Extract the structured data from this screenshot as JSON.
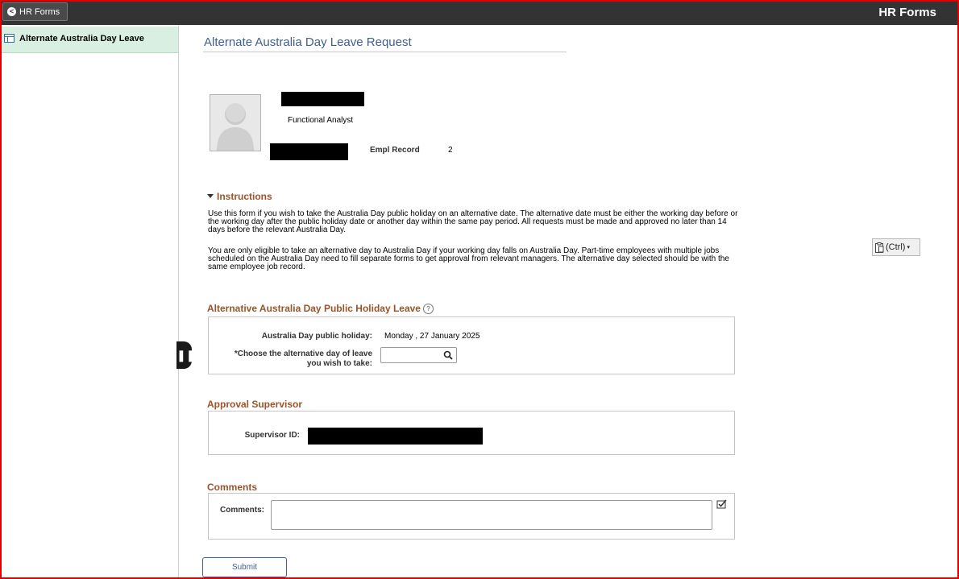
{
  "header": {
    "back_label": "HR Forms",
    "app_title": "HR Forms"
  },
  "sidebar": {
    "items": [
      {
        "label": "Alternate Australia Day Leave"
      }
    ]
  },
  "page": {
    "title": "Alternate Australia Day Leave Request"
  },
  "employee": {
    "job_title": "Functional Analyst",
    "empl_record_label": "Empl Record",
    "empl_record_value": "2"
  },
  "instructions": {
    "header": "Instructions",
    "paragraphs": [
      "Use this form if you wish to take the Australia Day public holiday on an alternative date. The alternative date must be either the working day before or the working day after the public holiday date or another day within the same pay period. All requests must be made and approved no later than 14 days before the relevant Australia Day.",
      "You are only eligible to take an alternative day to Australia Day if your working day falls on Australia Day. Part-time employees with multiple jobs scheduled on the Australia Day need to fill separate forms to get approval from relevant managers. The alternative day selected should be with the same employee job record."
    ]
  },
  "leave": {
    "header": "Alternative Australia Day Public Holiday Leave",
    "holiday_label": "Australia Day public holiday:",
    "holiday_value": "Monday   , 27 January 2025",
    "choose_label_1": "*Choose the alternative day of leave",
    "choose_label_2": "you wish to take:",
    "date_value": ""
  },
  "approval": {
    "header": "Approval Supervisor",
    "supervisor_label": "Supervisor ID:"
  },
  "comments": {
    "header": "Comments",
    "label": "Comments:",
    "value": ""
  },
  "actions": {
    "submit_label": "Submit",
    "paste_label": "(Ctrl)"
  },
  "icons": [
    "back-chevron-icon",
    "form-icon",
    "person-silhouette-icon",
    "triangle-down-icon",
    "help-icon",
    "search-icon",
    "spellcheck-icon",
    "clipboard-icon",
    "pause-icon"
  ],
  "colors": {
    "topbar": "#333333",
    "sidebar_selected": "#d9efe1",
    "section_header": "#99542a",
    "title": "#3d5f91",
    "frame": "#e00000"
  }
}
